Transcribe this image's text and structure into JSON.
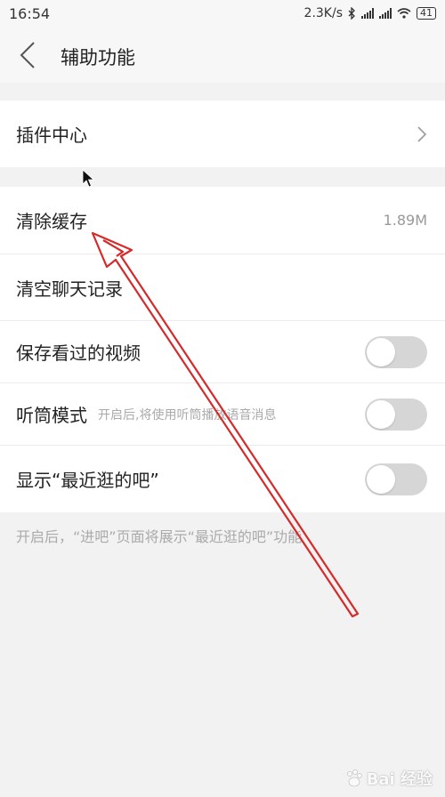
{
  "status_bar": {
    "time": "16:54",
    "speed": "2.3K/s",
    "battery": "41"
  },
  "header": {
    "title": "辅助功能"
  },
  "sections": {
    "plugins": {
      "label": "插件中心"
    },
    "storage": {
      "clear_cache": {
        "label": "清除缓存",
        "value": "1.89M"
      },
      "clear_chat": {
        "label": "清空聊天记录"
      },
      "save_videos": {
        "label": "保存看过的视频",
        "enabled": false
      },
      "earpiece_mode": {
        "label": "听筒模式",
        "sub": "开启后,将使用听筒播放语音消息",
        "enabled": false
      },
      "recent_bars": {
        "label": "显示“最近逛的吧”",
        "enabled": false
      }
    }
  },
  "footer": {
    "note": "开启后，“进吧”页面将展示“最近逛的吧”功能"
  },
  "watermark": {
    "text": "Bai  经验"
  },
  "colors": {
    "background": "#f2f2f2",
    "card": "#ffffff",
    "toggle_off": "#d6d6d6",
    "annotation": "#d62a2a"
  }
}
